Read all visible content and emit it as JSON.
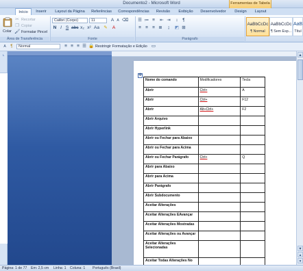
{
  "window": {
    "title": "Documento2 - Microsoft Word",
    "contextual_tab_group": "Ferramentas de Tabela"
  },
  "ribbon_tabs": [
    "Início",
    "Inserir",
    "Layout da Página",
    "Referências",
    "Correspondências",
    "Revisão",
    "Exibição",
    "Desenvolvedor",
    "Design",
    "Layout"
  ],
  "clipboard": {
    "paste_label": "Colar",
    "cut_label": "Recortar",
    "copy_label": "Copiar",
    "format_painter_label": "Formatar Pincel",
    "group_label": "Área de Transferência"
  },
  "font": {
    "name": "Calibri (Corpo)",
    "size": "11",
    "group_label": "Fonte"
  },
  "paragraph": {
    "group_label": "Parágrafo"
  },
  "styles": [
    {
      "sample": "AaBbCcDc",
      "name": "¶ Normal"
    },
    {
      "sample": "AaBbCcDc",
      "name": "¶ Sem Esp..."
    },
    {
      "sample": "AaB",
      "name": "Títul"
    }
  ],
  "format_strip": {
    "style_value": "Normal",
    "restrict_label": "Restringir Formatação e Edição"
  },
  "table": {
    "headers": [
      "Nome do comando",
      "Modificadores",
      "Tecla"
    ],
    "rows": [
      [
        "Abrir",
        "Ctrl+",
        "A"
      ],
      [
        "Abrir",
        "Ctrl+",
        "F12"
      ],
      [
        "Abrir",
        "Alt+Ctrl+",
        "F2"
      ],
      [
        "Abrir Arquivo",
        "",
        ""
      ],
      [
        "Abrir Hyperlink",
        "",
        ""
      ],
      [
        "Abrir ou Fechar para Abaixo",
        "",
        ""
      ],
      [
        "Abrir ou Fechar para Acima",
        "",
        ""
      ],
      [
        "Abrir ou Fechar Parágrafo",
        "Ctrl+",
        "Q"
      ],
      [
        "Abrir para Abaixo",
        "",
        ""
      ],
      [
        "Abrir para Acima",
        "",
        ""
      ],
      [
        "Abrir Parágrafo",
        "",
        ""
      ],
      [
        "Abrir Subdocumento",
        "",
        ""
      ],
      [
        "Aceitar Alterações",
        "",
        ""
      ],
      [
        "Aceitar Alterações EAvançar",
        "",
        ""
      ],
      [
        "Aceitar Alterações Mostradas",
        "",
        ""
      ],
      [
        "Aceitar Alterações ou Avançar",
        "",
        ""
      ],
      [
        "Aceitar Alterações Selecionadas",
        "",
        ""
      ],
      [
        "Aceitar Todas Alterações No",
        "",
        ""
      ]
    ]
  },
  "status_bar": {
    "page": "Página: 1 de 77",
    "position": "Em: 2,5 cm",
    "line": "Linha: 1",
    "column": "Coluna: 1",
    "language": "Português (Brasil)"
  },
  "colors": {
    "nav_pane": "#2f5aa3",
    "ribbon_bg": "#dbe7f6",
    "context_tab": "#f6cc72",
    "active_style": "#ffe19a"
  }
}
